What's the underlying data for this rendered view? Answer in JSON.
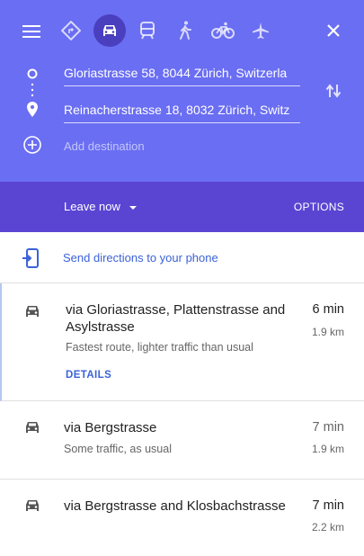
{
  "header": {
    "travel_modes": [
      {
        "name": "best-route",
        "icon": "diamond-turn-icon",
        "active": false
      },
      {
        "name": "driving",
        "icon": "car-icon",
        "active": true
      },
      {
        "name": "transit",
        "icon": "train-icon",
        "active": false
      },
      {
        "name": "walking",
        "icon": "walking-icon",
        "active": false
      },
      {
        "name": "cycling",
        "icon": "bicycle-icon",
        "active": false
      },
      {
        "name": "flights",
        "icon": "airplane-icon",
        "active": false
      }
    ],
    "origin": "Gloriastrasse 58, 8044 Zürich, Switzerla",
    "destination": "Reinacherstrasse 18, 8032 Zürich, Switz",
    "add_destination": "Add destination"
  },
  "departure": {
    "leave_now": "Leave now",
    "options": "OPTIONS"
  },
  "send": {
    "label": "Send directions to your phone"
  },
  "routes": [
    {
      "title": "via Gloriastrasse, Plattenstrasse and Asylstrasse",
      "description": "Fastest route, lighter traffic than usual",
      "time": "6 min",
      "distance": "1.9 km",
      "details": "DETAILS"
    },
    {
      "title": "via Bergstrasse",
      "description": "Some traffic, as usual",
      "time": "7 min",
      "distance": "1.9 km"
    },
    {
      "title": "via Bergstrasse and Klosbachstrasse",
      "description": "",
      "time": "7 min",
      "distance": "2.2 km"
    }
  ],
  "colors": {
    "header": "#6a6ef2",
    "bar": "#5a45d3",
    "active_mode": "#4a3fbf",
    "link": "#3b62d8",
    "fastest_time": "#222222",
    "slower_time": "#666666"
  }
}
